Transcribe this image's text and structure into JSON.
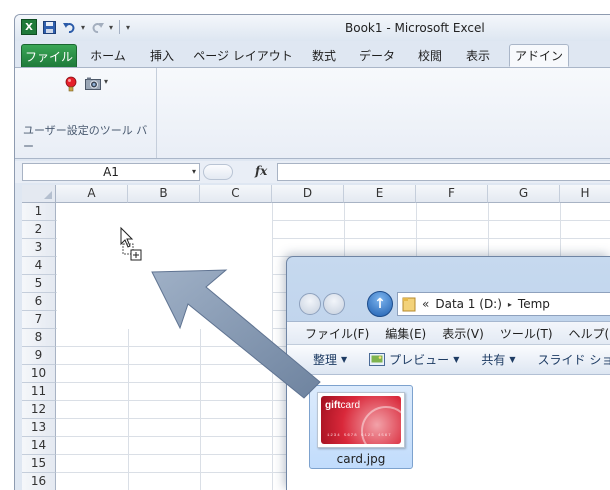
{
  "excel": {
    "title": "Book1  -  Microsoft Excel",
    "qat": {
      "logo": "X",
      "save_icon": "save-icon",
      "undo_icon": "undo-icon",
      "redo_icon": "redo-icon"
    },
    "tabs": [
      {
        "label": "ファイル",
        "active": false,
        "file": true
      },
      {
        "label": "ホーム"
      },
      {
        "label": "挿入"
      },
      {
        "label": "ページ レイアウト"
      },
      {
        "label": "数式"
      },
      {
        "label": "データ"
      },
      {
        "label": "校閲"
      },
      {
        "label": "表示"
      },
      {
        "label": "アドイン",
        "active": true
      }
    ],
    "ribbon": {
      "group_label": "ユーザー設定のツール バー",
      "icons": [
        "lightbulb-icon",
        "camera-icon"
      ]
    },
    "formula_bar": {
      "name_box": "A1",
      "fx": "fx",
      "formula": ""
    },
    "columns": [
      "A",
      "B",
      "C",
      "D",
      "E",
      "F",
      "G",
      "H"
    ],
    "rows": [
      "1",
      "2",
      "3",
      "4",
      "5",
      "6",
      "7",
      "8",
      "9",
      "10",
      "11",
      "12",
      "13",
      "14",
      "15",
      "16"
    ]
  },
  "explorer": {
    "address": {
      "chevron": "«",
      "drive": "Data 1 (D:)",
      "sep": "▸",
      "folder": "Temp"
    },
    "menu": [
      "ファイル(F)",
      "編集(E)",
      "表示(V)",
      "ツール(T)",
      "ヘルプ(H)"
    ],
    "commands": [
      {
        "label": "整理",
        "dropdown": true
      },
      {
        "label": "プレビュー",
        "dropdown": true,
        "icon": "preview-icon"
      },
      {
        "label": "共有",
        "dropdown": true
      },
      {
        "label": "スライド ショー",
        "dropdown": false
      }
    ],
    "file": {
      "name": "card.jpg",
      "thumb_brand_bold": "gift",
      "thumb_brand_light": "card",
      "thumb_number": "1234 5678 9123 4567"
    }
  },
  "colors": {
    "excel_file_tab": "#1e7a3a",
    "ribbon_bg": "#f7f9fc",
    "explorer_frame": "#c6d9ef",
    "selection": "#c1dcfc",
    "drag_arrow": "#7f93ad"
  }
}
